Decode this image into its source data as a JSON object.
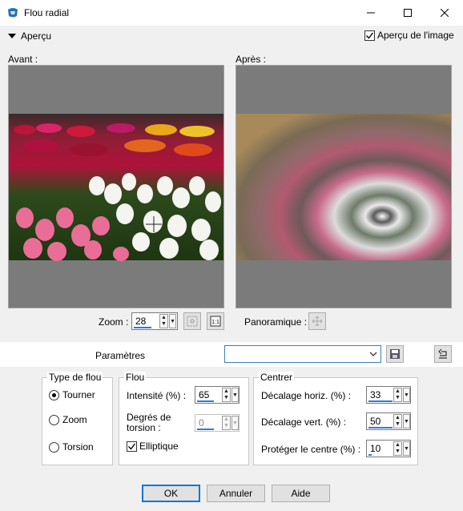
{
  "window": {
    "title": "Flou radial"
  },
  "preview": {
    "toggle_label": "Aperçu",
    "image_preview_label": "Aperçu de l'image",
    "before_label": "Avant :",
    "after_label": "Après :"
  },
  "zoom": {
    "label": "Zoom :",
    "value": "28"
  },
  "panoramic": {
    "label": "Panoramique :"
  },
  "params": {
    "label": "Paramètres",
    "preset_value": ""
  },
  "blur_type": {
    "title": "Type de flou",
    "options": [
      "Tourner",
      "Zoom",
      "Torsion"
    ],
    "selected": "Tourner"
  },
  "flou": {
    "title": "Flou",
    "intensity_label": "Intensité (%) :",
    "intensity_value": "65",
    "twist_label_1": "Degrés de",
    "twist_label_2": "torsion :",
    "twist_value": "0",
    "elliptic_label": "Elliptique"
  },
  "center": {
    "title": "Centrer",
    "h_offset_label": "Décalage horiz. (%) :",
    "h_offset_value": "33",
    "v_offset_label": "Décalage vert. (%) :",
    "v_offset_value": "50",
    "protect_label": "Protéger le centre (%) :",
    "protect_value": "10"
  },
  "buttons": {
    "ok": "OK",
    "cancel": "Annuler",
    "help": "Aide"
  },
  "colors": {
    "accent": "#2f7ad8",
    "focus": "#0078d7",
    "preview_bg": "#7b7b7b"
  }
}
